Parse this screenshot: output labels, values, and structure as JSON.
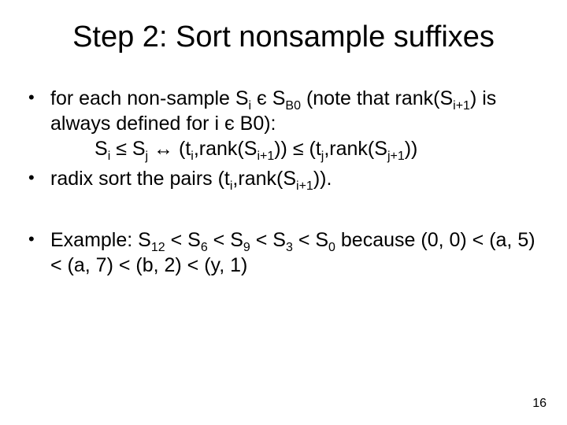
{
  "title": "Step 2: Sort nonsample suffixes",
  "bullets": {
    "b1": {
      "line1a": "for each non-sample  S",
      "sub1": "i",
      "line1b": " є S",
      "sub2": "B0",
      "line1c": "  (note that rank(S",
      "sub3": "i+1",
      "line1d": ") is always defined for i є B0):",
      "indent_a": "S",
      "indent_sub1": "i",
      "indent_b": " ≤ S",
      "indent_sub2": "j",
      "indent_c": "   ↔  (t",
      "indent_sub3": "i",
      "indent_d": ",rank(S",
      "indent_sub4": "i+1",
      "indent_e": ")) ≤ (t",
      "indent_sub5": "j",
      "indent_f": ",rank(S",
      "indent_sub6": "j+1",
      "indent_g": "))"
    },
    "b2": {
      "a": "radix sort the pairs (t",
      "sub1": "i",
      "b": ",rank(S",
      "sub2": "i+1",
      "c": "))."
    },
    "b3": {
      "a": "Example: S",
      "s1": "12",
      "b": " < S",
      "s2": "6",
      "c": " < S",
      "s3": "9",
      "d": " < S",
      "s4": "3",
      "e": " < S",
      "s5": "0",
      "f": "  because (0, 0) < (a, 5) < (a, 7) < (b, 2) < (y, 1)"
    }
  },
  "bulletchar": "•",
  "pagenum": "16"
}
